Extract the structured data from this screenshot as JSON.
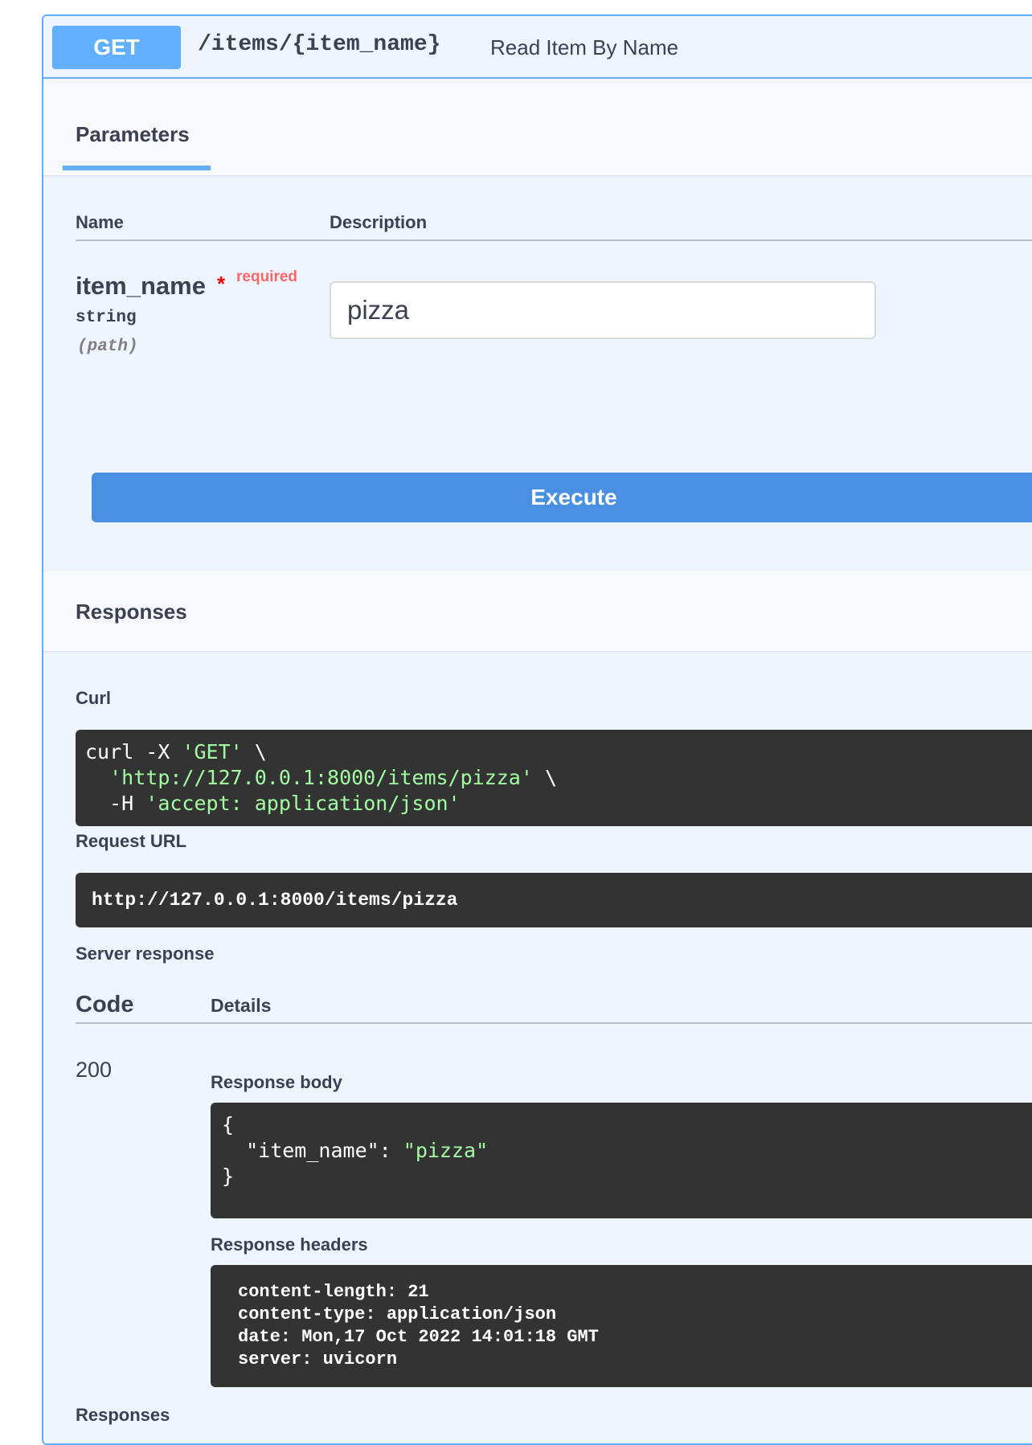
{
  "operation": {
    "method": "GET",
    "path": "/items/{item_name}",
    "description": "Read Item By Name"
  },
  "parameters": {
    "tab_label": "Parameters",
    "col_name": "Name",
    "col_description": "Description",
    "param": {
      "name": "item_name",
      "required_star": "*",
      "required_label": "required",
      "type": "string",
      "in": "(path)",
      "value": "pizza"
    }
  },
  "execute_label": "Execute",
  "responses": {
    "title": "Responses",
    "curl_label": "Curl",
    "curl": {
      "l1a": "curl -X ",
      "l1s": "'GET'",
      "l1b": " \\",
      "l2a": "  ",
      "l2s": "'http://127.0.0.1:8000/items/pizza'",
      "l2b": " \\",
      "l3a": "  -H ",
      "l3s": "'accept: application/json'"
    },
    "request_url_label": "Request URL",
    "request_url": "http://127.0.0.1:8000/items/pizza",
    "server_response_label": "Server response",
    "col_code": "Code",
    "col_details": "Details",
    "status_code": "200",
    "response_body_label": "Response body",
    "body": {
      "open": "{",
      "key": "  \"item_name\": ",
      "val": "\"pizza\"",
      "close": "}"
    },
    "response_headers_label": "Response headers",
    "headers": [
      "content-length: 21",
      "content-type: application/json",
      "date: Mon,17 Oct 2022 14:01:18 GMT",
      "server: uvicorn"
    ],
    "footer_label": "Responses"
  },
  "colors": {
    "get_accent": "#61affe",
    "execute": "#4990e2",
    "code_bg": "#333333",
    "string_green": "#a2fca2",
    "required_red": "#ff6666"
  }
}
